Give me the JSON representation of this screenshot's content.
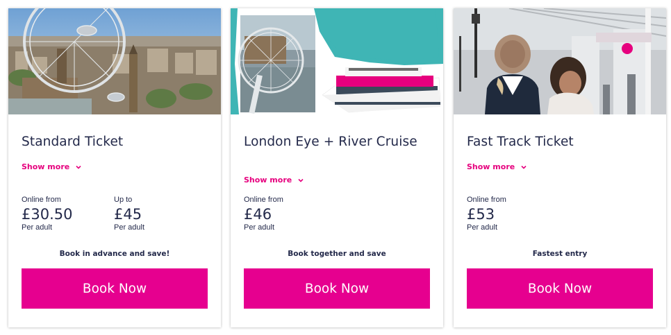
{
  "cards": [
    {
      "title": "Standard Ticket",
      "show_more": "Show more",
      "prices": [
        {
          "label": "Online from",
          "value": "£30.50",
          "sub": "Per adult"
        },
        {
          "label": "Up to",
          "value": "£45",
          "sub": "Per adult"
        }
      ],
      "tagline": "Book in advance and save!",
      "button": "Book Now"
    },
    {
      "title": "London Eye + River Cruise",
      "show_more": "Show more",
      "prices": [
        {
          "label": "Online from",
          "value": "£46",
          "sub": "Per adult"
        }
      ],
      "tagline": "Book together and save",
      "button": "Book Now"
    },
    {
      "title": "Fast Track Ticket",
      "show_more": "Show more",
      "prices": [
        {
          "label": "Online from",
          "value": "£53",
          "sub": "Per adult"
        }
      ],
      "tagline": "Fastest entry",
      "button": "Book Now"
    }
  ],
  "colors": {
    "accent": "#e6008f",
    "text": "#23294a",
    "teal_background": "#3fb5b5"
  },
  "icons": {
    "show_more": "chevron-down-icon"
  }
}
